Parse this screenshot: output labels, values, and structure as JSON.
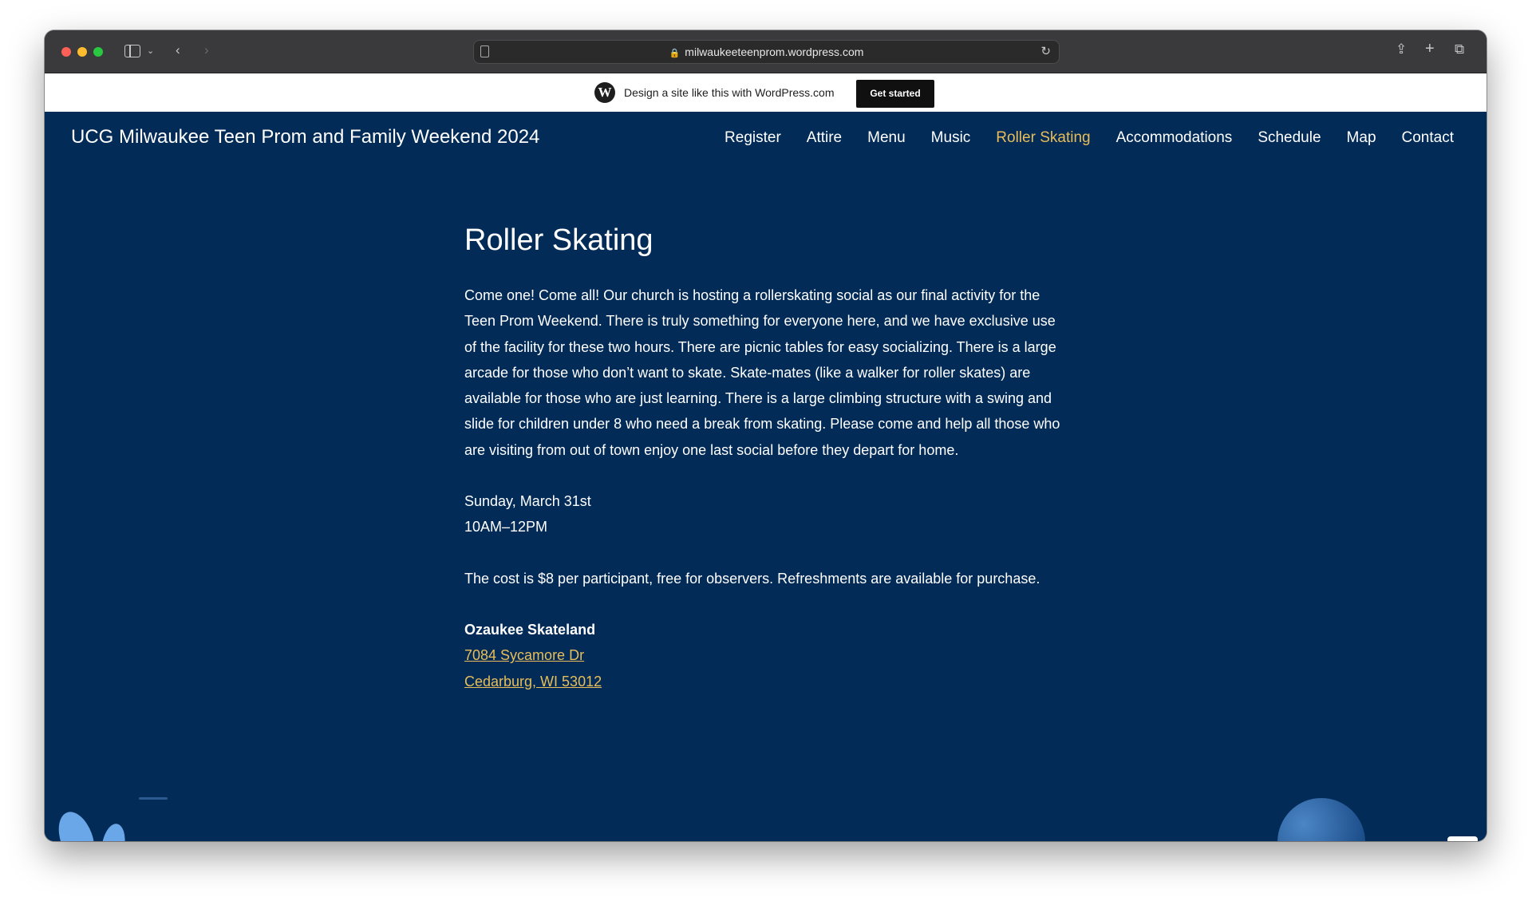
{
  "browser": {
    "url": "milwaukeeteenprom.wordpress.com"
  },
  "wp_banner": {
    "text": "Design a site like this with WordPress.com",
    "cta": "Get started"
  },
  "site": {
    "title": "UCG Milwaukee Teen Prom and Family Weekend 2024",
    "nav": [
      {
        "label": "Register"
      },
      {
        "label": "Attire"
      },
      {
        "label": "Menu"
      },
      {
        "label": "Music"
      },
      {
        "label": "Roller Skating",
        "active": true
      },
      {
        "label": "Accommodations"
      },
      {
        "label": "Schedule"
      },
      {
        "label": "Map"
      },
      {
        "label": "Contact"
      }
    ]
  },
  "page": {
    "heading": "Roller Skating",
    "intro": "Come one! Come all! Our church is hosting a rollerskating social as our final activity for the Teen Prom Weekend. There is truly something for everyone here, and we have exclusive use of the facility for these two hours. There are picnic tables for easy socializing. There is a large arcade for those who don’t want to skate. Skate-mates (like a walker for roller skates) are available for those who are just learning. There is a large climbing structure with a swing and slide for children under 8 who need a break from skating. Please come and help all those who are visiting from out of town enjoy one last social before they depart for home.",
    "date": "Sunday, March 31st",
    "time": "10AM–12PM",
    "cost": "The cost is $8 per participant, free for observers. Refreshments are available for purchase.",
    "venue_name": "Ozaukee Skateland",
    "address_line1": "7084 Sycamore Dr",
    "address_line2": "Cedarburg, WI 53012"
  },
  "colors": {
    "background": "#022b57",
    "accent": "#e8bd5a"
  }
}
